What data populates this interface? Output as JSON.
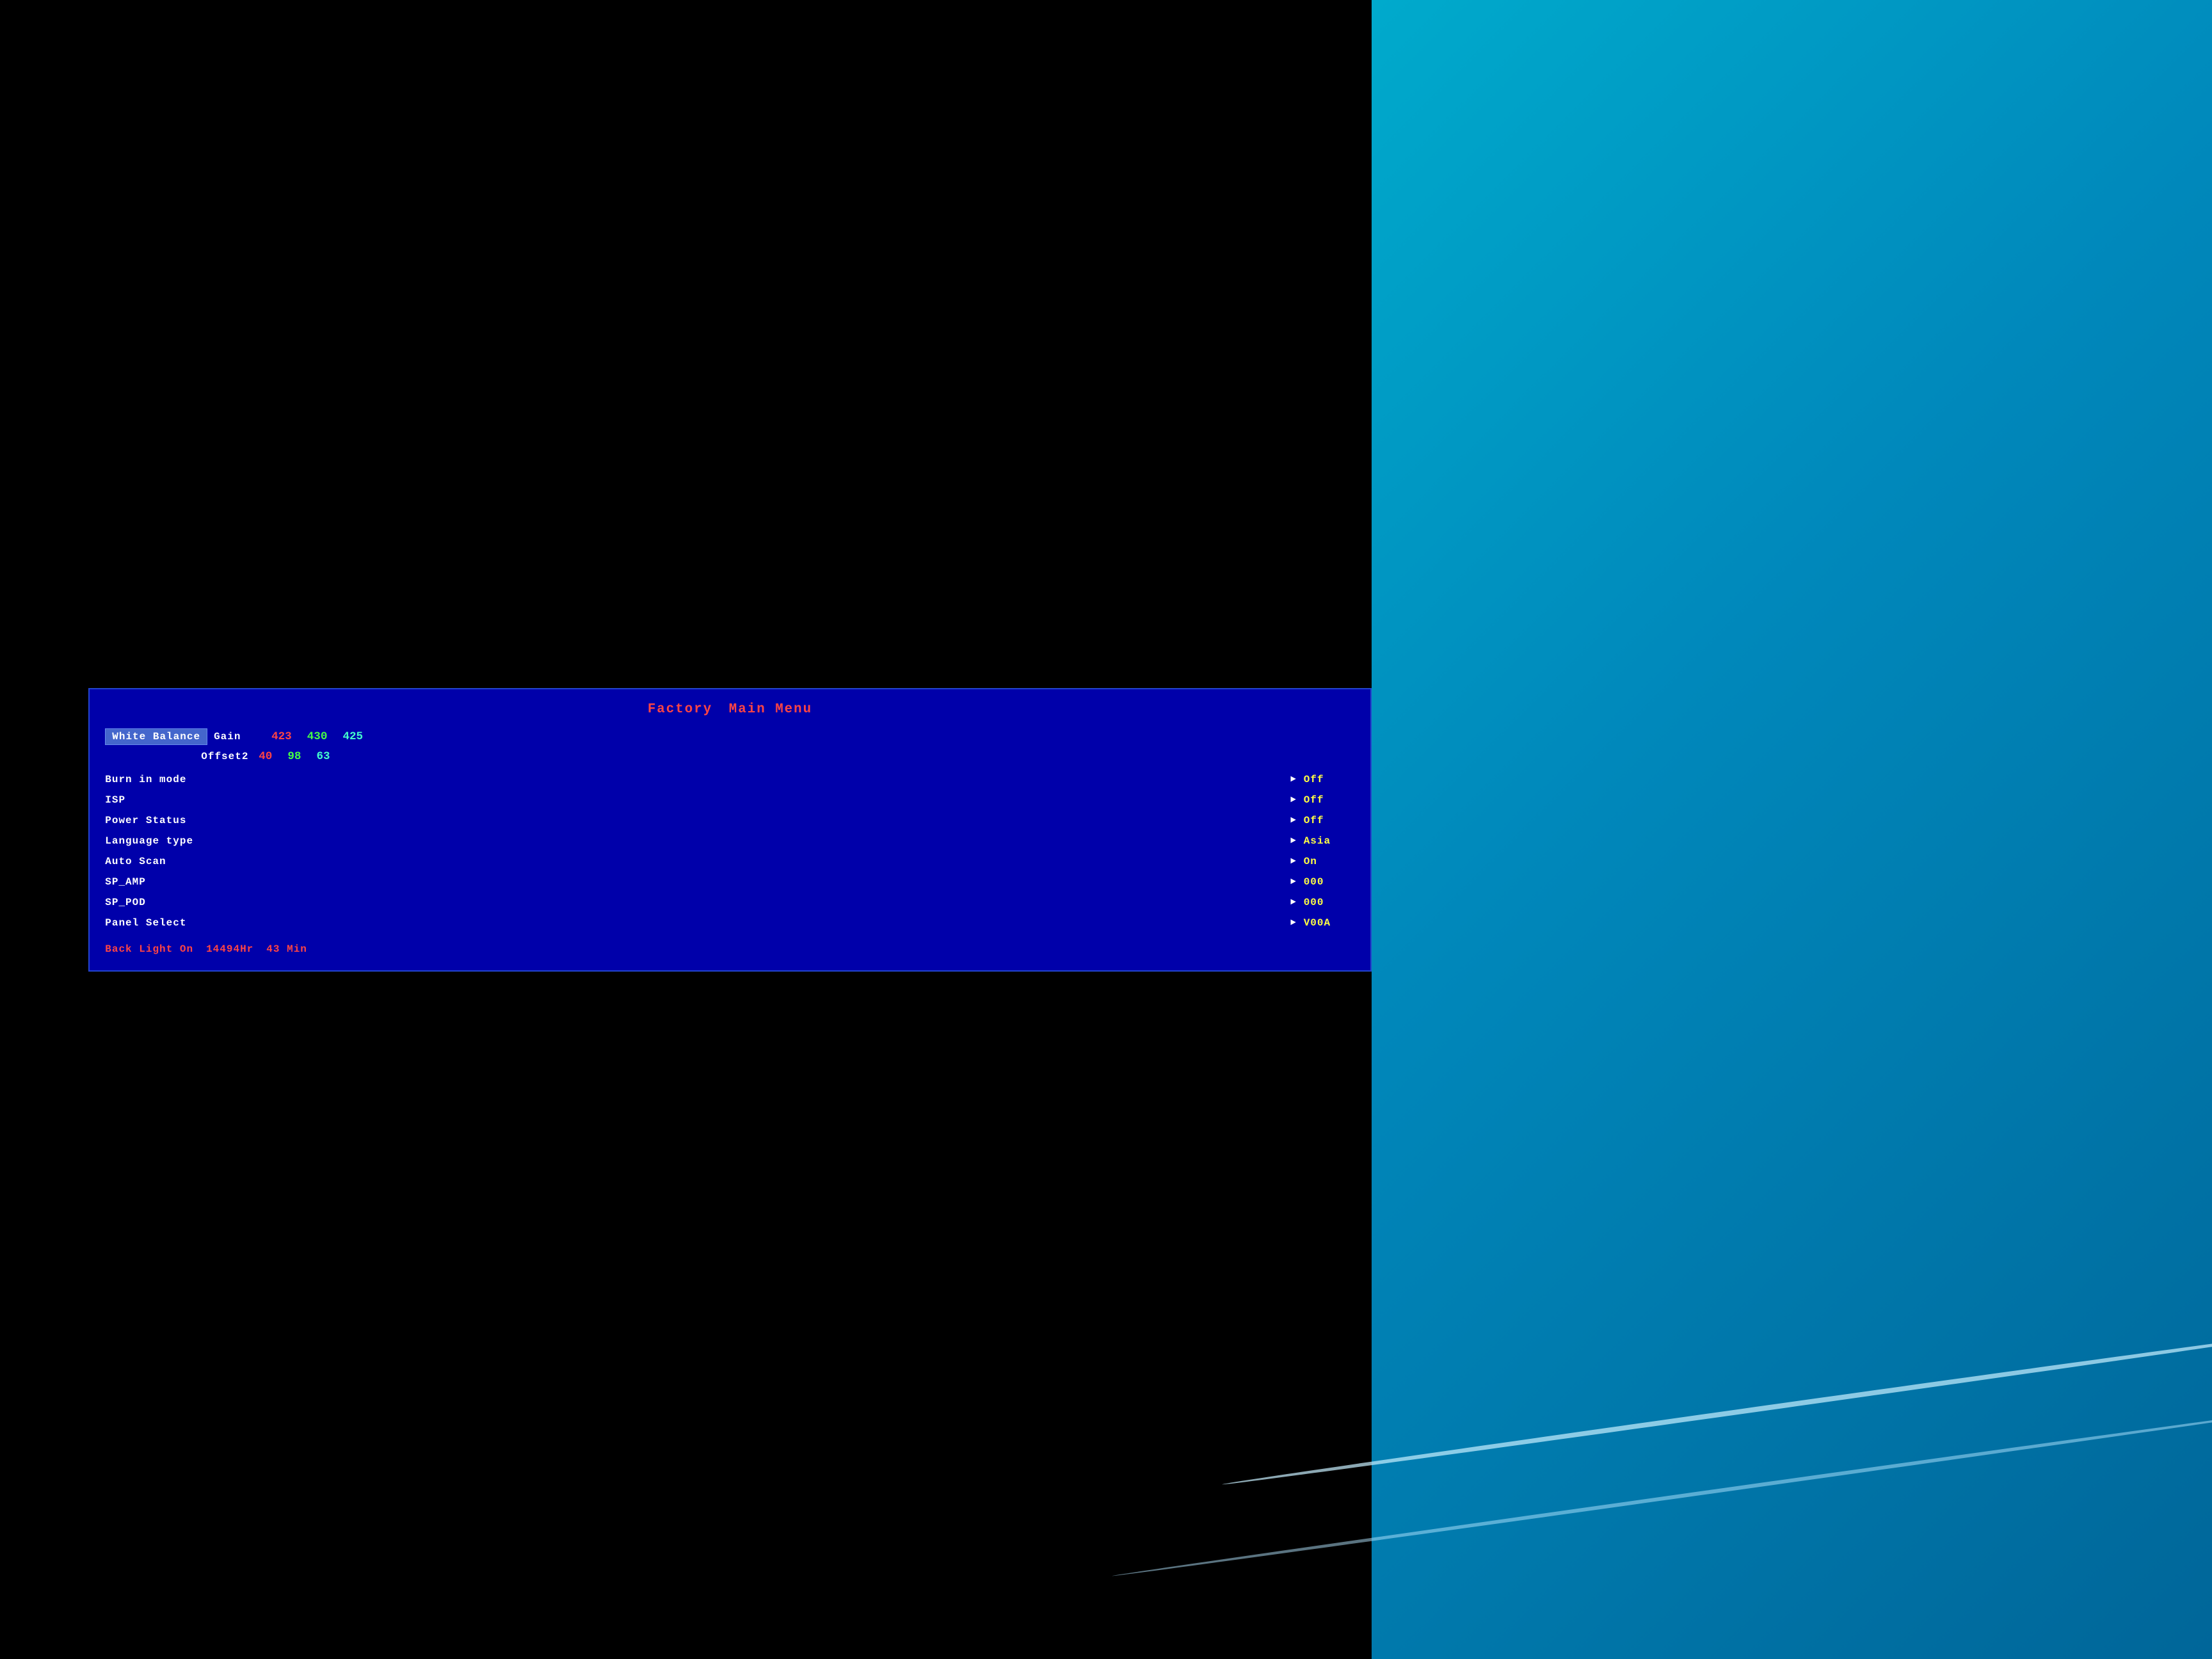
{
  "title": {
    "factory": "Factory",
    "main_menu": "Main Menu"
  },
  "white_balance": {
    "label": "White Balance",
    "gain": {
      "label": "Gain",
      "red": "423",
      "green": "430",
      "cyan": "425"
    },
    "offset2": {
      "label": "Offset2",
      "red": "40",
      "green": "98",
      "cyan": "63"
    }
  },
  "menu_items": [
    {
      "label": "Burn in mode",
      "value": "Off"
    },
    {
      "label": "ISP",
      "value": "Off"
    },
    {
      "label": "Power Status",
      "value": "Off"
    },
    {
      "label": "Language type",
      "value": "Asia"
    },
    {
      "label": "Auto Scan",
      "value": "On"
    },
    {
      "label": "SP_AMP",
      "value": "000"
    },
    {
      "label": "SP_POD",
      "value": "000"
    },
    {
      "label": "Panel Select",
      "value": "V00A"
    }
  ],
  "backlight": {
    "label": "Back Light On",
    "hours_value": "14494Hr",
    "min_value": "43 Min"
  },
  "arrow_symbol": "►"
}
